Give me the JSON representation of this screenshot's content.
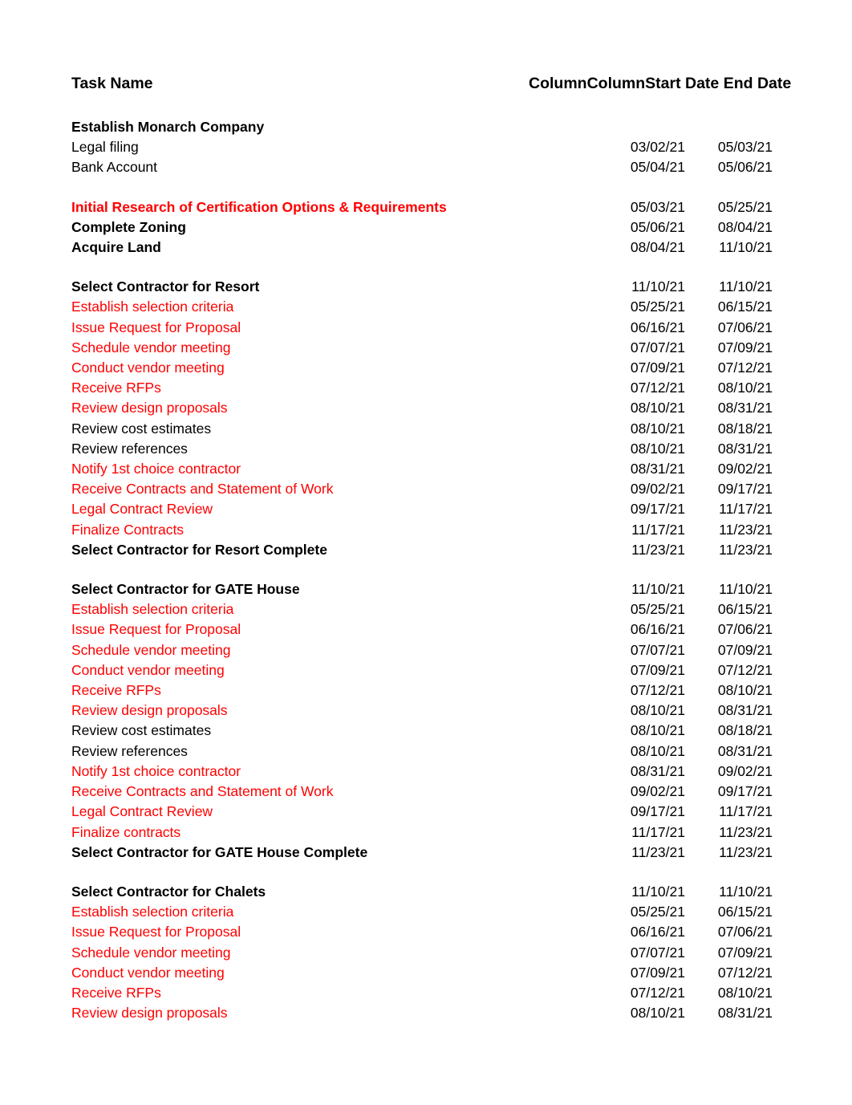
{
  "document": {
    "title": "Task Name",
    "columns": {
      "task_name": "Task Name",
      "column_a": "Column",
      "column_b": "Column",
      "start_date": "Start Date",
      "end_date": "End Date"
    },
    "colors": {
      "text": "#000000",
      "highlight": "#ff0000",
      "background": "#ffffff"
    }
  },
  "rows": [
    {
      "task": "Establish Monarch Company",
      "start": "",
      "end": "",
      "bold": true,
      "red": false,
      "spacer": false
    },
    {
      "task": "Legal filing",
      "start": "03/02/21",
      "end": "05/03/21",
      "bold": false,
      "red": false,
      "spacer": false
    },
    {
      "task": "Bank Account",
      "start": "05/04/21",
      "end": "05/06/21",
      "bold": false,
      "red": false,
      "spacer": false
    },
    {
      "task": "",
      "start": "",
      "end": "",
      "bold": false,
      "red": false,
      "spacer": true
    },
    {
      "task": "Initial Research of Certification Options & Requirements",
      "start": "05/03/21",
      "end": "05/25/21",
      "bold": true,
      "red": true,
      "spacer": false
    },
    {
      "task": "Complete Zoning",
      "start": "05/06/21",
      "end": "08/04/21",
      "bold": true,
      "red": false,
      "spacer": false
    },
    {
      "task": "Acquire Land",
      "start": "08/04/21",
      "end": "11/10/21",
      "bold": true,
      "red": false,
      "spacer": false
    },
    {
      "task": "",
      "start": "",
      "end": "",
      "bold": false,
      "red": false,
      "spacer": true
    },
    {
      "task": "Select Contractor for Resort",
      "start": "11/10/21",
      "end": "11/10/21",
      "bold": true,
      "red": false,
      "spacer": false
    },
    {
      "task": "Establish selection criteria",
      "start": "05/25/21",
      "end": "06/15/21",
      "bold": false,
      "red": true,
      "spacer": false
    },
    {
      "task": "Issue Request for Proposal",
      "start": "06/16/21",
      "end": "07/06/21",
      "bold": false,
      "red": true,
      "spacer": false
    },
    {
      "task": "Schedule vendor meeting",
      "start": "07/07/21",
      "end": "07/09/21",
      "bold": false,
      "red": true,
      "spacer": false
    },
    {
      "task": "Conduct vendor meeting",
      "start": "07/09/21",
      "end": "07/12/21",
      "bold": false,
      "red": true,
      "spacer": false
    },
    {
      "task": "Receive RFPs",
      "start": "07/12/21",
      "end": "08/10/21",
      "bold": false,
      "red": true,
      "spacer": false
    },
    {
      "task": "Review design proposals",
      "start": "08/10/21",
      "end": "08/31/21",
      "bold": false,
      "red": true,
      "spacer": false
    },
    {
      "task": "Review cost estimates",
      "start": "08/10/21",
      "end": "08/18/21",
      "bold": false,
      "red": false,
      "spacer": false
    },
    {
      "task": "Review references",
      "start": "08/10/21",
      "end": "08/31/21",
      "bold": false,
      "red": false,
      "spacer": false
    },
    {
      "task": "Notify 1st choice contractor",
      "start": "08/31/21",
      "end": "09/02/21",
      "bold": false,
      "red": true,
      "spacer": false
    },
    {
      "task": "Receive Contracts and Statement of Work",
      "start": "09/02/21",
      "end": "09/17/21",
      "bold": false,
      "red": true,
      "spacer": false
    },
    {
      "task": "Legal Contract Review",
      "start": "09/17/21",
      "end": "11/17/21",
      "bold": false,
      "red": true,
      "spacer": false
    },
    {
      "task": "Finalize Contracts",
      "start": "11/17/21",
      "end": "11/23/21",
      "bold": false,
      "red": true,
      "spacer": false
    },
    {
      "task": "Select Contractor for Resort Complete",
      "start": "11/23/21",
      "end": "11/23/21",
      "bold": true,
      "red": false,
      "spacer": false
    },
    {
      "task": "",
      "start": "",
      "end": "",
      "bold": false,
      "red": false,
      "spacer": true
    },
    {
      "task": "Select Contractor for GATE House",
      "start": "11/10/21",
      "end": "11/10/21",
      "bold": true,
      "red": false,
      "spacer": false
    },
    {
      "task": "Establish selection criteria",
      "start": "05/25/21",
      "end": "06/15/21",
      "bold": false,
      "red": true,
      "spacer": false
    },
    {
      "task": "Issue Request for Proposal",
      "start": "06/16/21",
      "end": "07/06/21",
      "bold": false,
      "red": true,
      "spacer": false
    },
    {
      "task": "Schedule vendor meeting",
      "start": "07/07/21",
      "end": "07/09/21",
      "bold": false,
      "red": true,
      "spacer": false
    },
    {
      "task": "Conduct vendor meeting",
      "start": "07/09/21",
      "end": "07/12/21",
      "bold": false,
      "red": true,
      "spacer": false
    },
    {
      "task": "Receive RFPs",
      "start": "07/12/21",
      "end": "08/10/21",
      "bold": false,
      "red": true,
      "spacer": false
    },
    {
      "task": "Review design proposals",
      "start": "08/10/21",
      "end": "08/31/21",
      "bold": false,
      "red": true,
      "spacer": false
    },
    {
      "task": "Review cost estimates",
      "start": "08/10/21",
      "end": "08/18/21",
      "bold": false,
      "red": false,
      "spacer": false
    },
    {
      "task": "Review references",
      "start": "08/10/21",
      "end": "08/31/21",
      "bold": false,
      "red": false,
      "spacer": false
    },
    {
      "task": "Notify 1st choice contractor",
      "start": "08/31/21",
      "end": "09/02/21",
      "bold": false,
      "red": true,
      "spacer": false
    },
    {
      "task": "Receive Contracts and Statement of Work",
      "start": "09/02/21",
      "end": "09/17/21",
      "bold": false,
      "red": true,
      "spacer": false
    },
    {
      "task": "Legal Contract Review",
      "start": "09/17/21",
      "end": "11/17/21",
      "bold": false,
      "red": true,
      "spacer": false
    },
    {
      "task": "Finalize contracts",
      "start": "11/17/21",
      "end": "11/23/21",
      "bold": false,
      "red": true,
      "spacer": false
    },
    {
      "task": "Select Contractor for GATE House Complete",
      "start": "11/23/21",
      "end": "11/23/21",
      "bold": true,
      "red": false,
      "spacer": false
    },
    {
      "task": "",
      "start": "",
      "end": "",
      "bold": false,
      "red": false,
      "spacer": true
    },
    {
      "task": "Select Contractor for Chalets",
      "start": "11/10/21",
      "end": "11/10/21",
      "bold": true,
      "red": false,
      "spacer": false
    },
    {
      "task": "Establish selection criteria",
      "start": "05/25/21",
      "end": "06/15/21",
      "bold": false,
      "red": true,
      "spacer": false
    },
    {
      "task": "Issue Request for Proposal",
      "start": "06/16/21",
      "end": "07/06/21",
      "bold": false,
      "red": true,
      "spacer": false
    },
    {
      "task": "Schedule vendor meeting",
      "start": "07/07/21",
      "end": "07/09/21",
      "bold": false,
      "red": true,
      "spacer": false
    },
    {
      "task": "Conduct vendor meeting",
      "start": "07/09/21",
      "end": "07/12/21",
      "bold": false,
      "red": true,
      "spacer": false
    },
    {
      "task": "Receive RFPs",
      "start": "07/12/21",
      "end": "08/10/21",
      "bold": false,
      "red": true,
      "spacer": false
    },
    {
      "task": "Review design proposals",
      "start": "08/10/21",
      "end": "08/31/21",
      "bold": false,
      "red": true,
      "spacer": false
    }
  ]
}
